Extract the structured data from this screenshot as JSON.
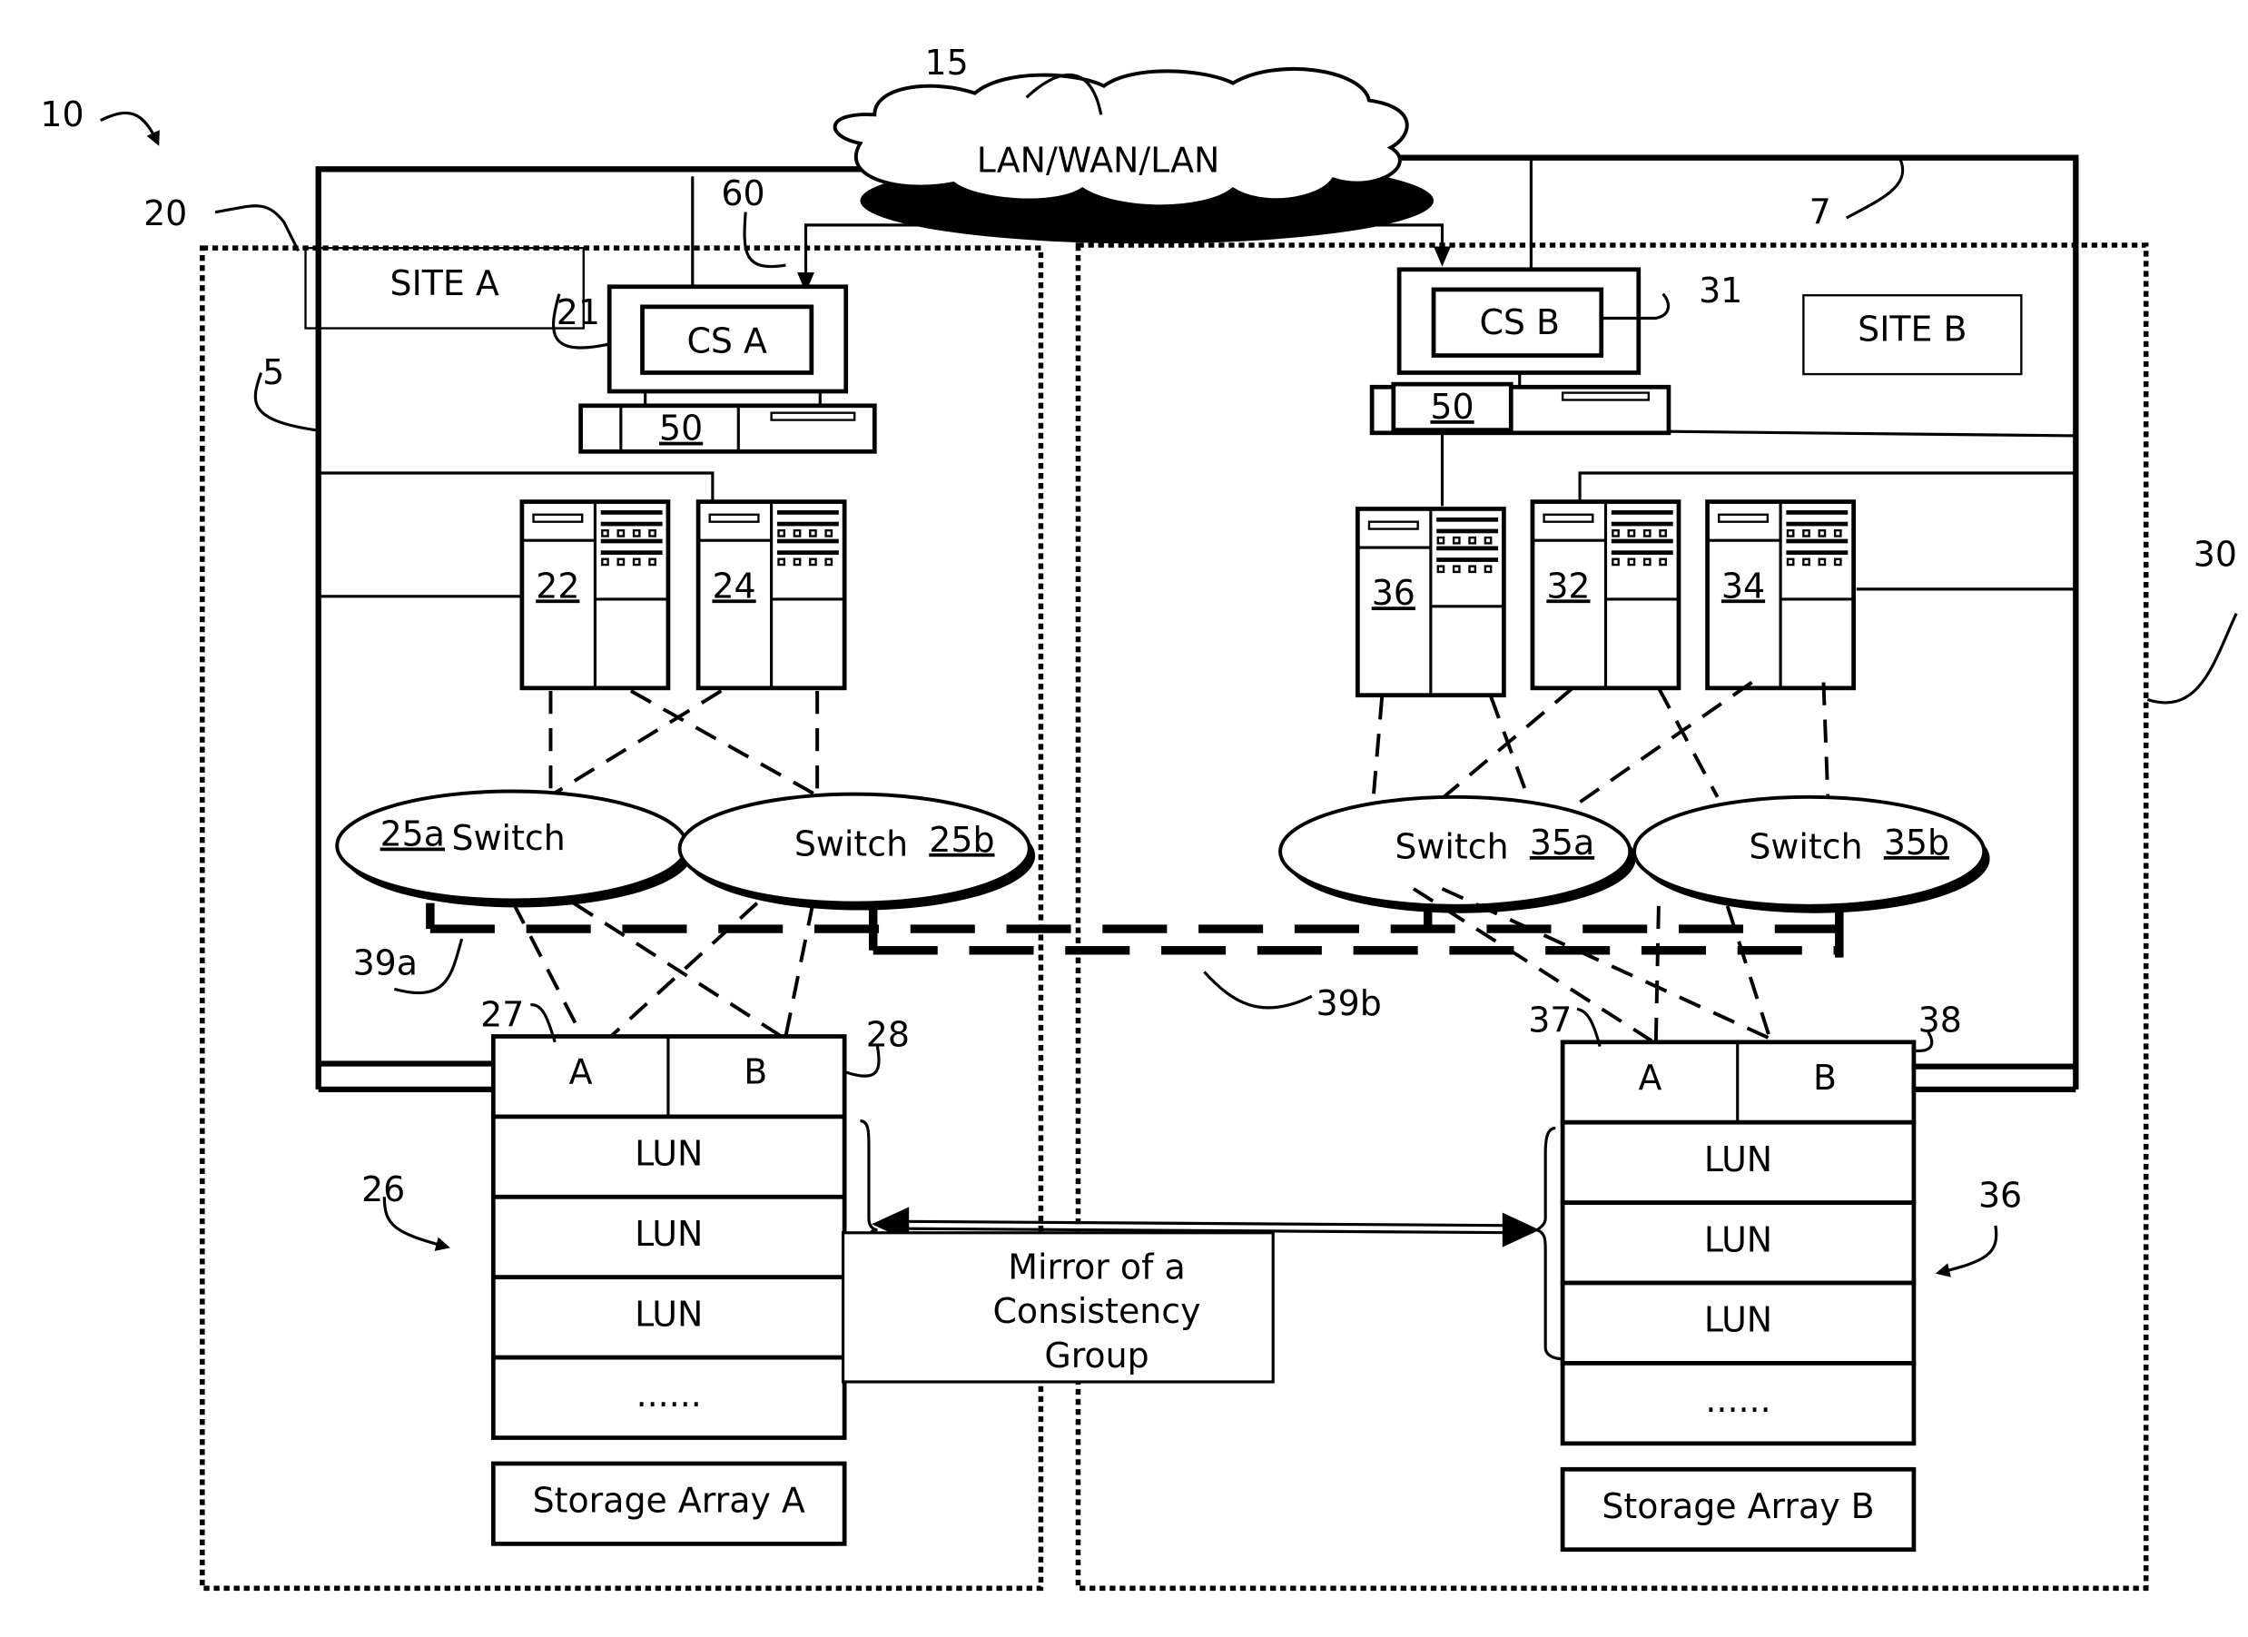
{
  "figure": {
    "system_ref": "10",
    "network": {
      "label": "LAN/WAN/LAN",
      "ref": "15"
    },
    "connection_refs": {
      "cs_link": "60",
      "bus_site_a": "5",
      "bus_site_b": "7"
    },
    "site_a": {
      "label": "SITE A",
      "ref": "20",
      "console": {
        "label": "CS A",
        "ref": "21",
        "unit_ref": "50"
      },
      "hosts": [
        {
          "ref": "22"
        },
        {
          "ref": "24"
        }
      ],
      "switches": [
        {
          "label": "Switch",
          "ref": "25a"
        },
        {
          "label": "Switch",
          "ref": "25b"
        }
      ],
      "fabric_ref": "39a",
      "storage": {
        "ref": "26",
        "ports": [
          {
            "label": "A",
            "ref": "27"
          },
          {
            "label": "B",
            "ref": "28"
          }
        ],
        "luns": [
          "LUN",
          "LUN",
          "LUN",
          "......"
        ],
        "name": "Storage Array A"
      }
    },
    "site_b": {
      "label": "SITE B",
      "ref": "30",
      "console": {
        "label": "CS B",
        "ref": "31",
        "unit_ref": "50"
      },
      "hosts": [
        {
          "ref": "36"
        },
        {
          "ref": "32"
        },
        {
          "ref": "34"
        }
      ],
      "switches": [
        {
          "label": "Switch",
          "ref": "35a"
        },
        {
          "label": "Switch",
          "ref": "35b"
        }
      ],
      "fabric_ref": "39b",
      "storage": {
        "ref": "36",
        "ports": [
          {
            "label": "A",
            "ref": "37"
          },
          {
            "label": "B",
            "ref": "38"
          }
        ],
        "luns": [
          "LUN",
          "LUN",
          "LUN",
          "......"
        ],
        "name": "Storage Array B"
      }
    },
    "mirror": {
      "line1": "Mirror of a",
      "line2": "Consistency",
      "line3": "Group"
    }
  }
}
